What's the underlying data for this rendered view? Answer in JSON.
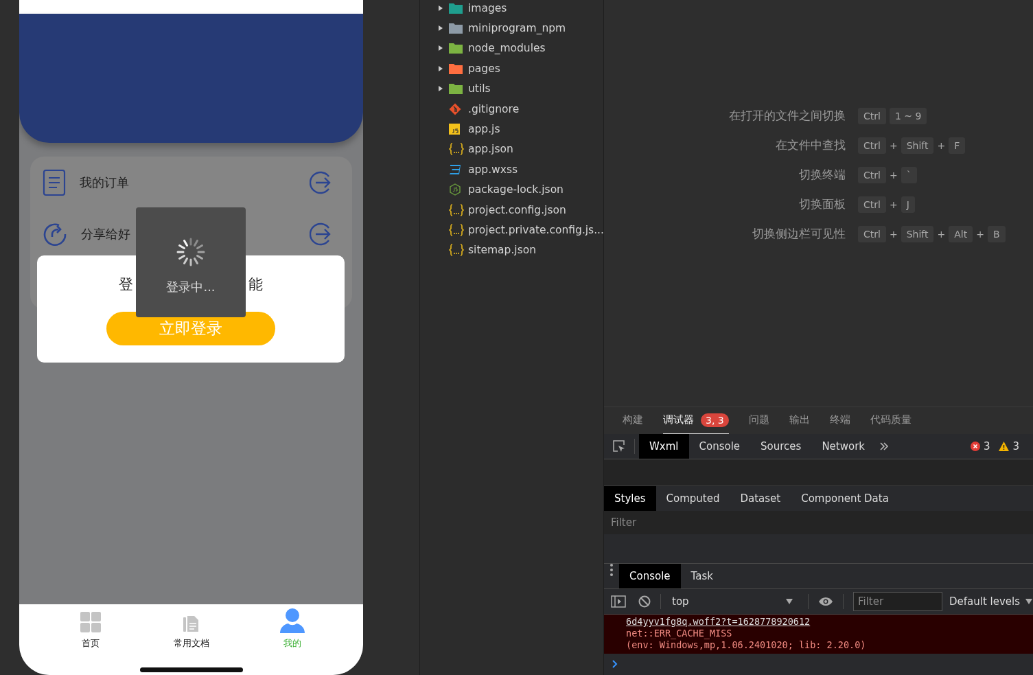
{
  "phone": {
    "menu": [
      {
        "label": "我的订单"
      },
      {
        "label": "分享给好"
      }
    ],
    "login_card": {
      "prompt_parts": [
        "登",
        "能"
      ],
      "button": "立即登录"
    },
    "toast": {
      "text": "登录中..."
    },
    "tab_bar": [
      {
        "label": "首页",
        "selected": false
      },
      {
        "label": "常用文档",
        "selected": false
      },
      {
        "label": "我的",
        "selected": true
      }
    ]
  },
  "file_tree": [
    {
      "name": "images",
      "kind": "folder",
      "color": "#1f9e8e",
      "expanded": false
    },
    {
      "name": "miniprogram_npm",
      "kind": "folder",
      "color": "#8d9aa6",
      "expanded": false
    },
    {
      "name": "node_modules",
      "kind": "folder",
      "color": "#7cb342",
      "expanded": false
    },
    {
      "name": "pages",
      "kind": "folder",
      "color": "#ff6e40",
      "expanded": false
    },
    {
      "name": "utils",
      "kind": "folder",
      "color": "#7cb342",
      "expanded": false
    },
    {
      "name": ".gitignore",
      "kind": "git"
    },
    {
      "name": "app.js",
      "kind": "js"
    },
    {
      "name": "app.json",
      "kind": "json"
    },
    {
      "name": "app.wxss",
      "kind": "css"
    },
    {
      "name": "package-lock.json",
      "kind": "node"
    },
    {
      "name": "project.config.json",
      "kind": "json"
    },
    {
      "name": "project.private.config.js...",
      "kind": "json"
    },
    {
      "name": "sitemap.json",
      "kind": "json"
    }
  ],
  "shortcuts": [
    {
      "label": "在打开的文件之间切换",
      "keys": [
        {
          "kind": "key",
          "text": "Ctrl"
        },
        {
          "kind": "key",
          "text": "1 ~ 9"
        }
      ]
    },
    {
      "label": "在文件中查找",
      "keys": [
        {
          "kind": "key",
          "text": "Ctrl"
        },
        {
          "kind": "plus",
          "text": "+"
        },
        {
          "kind": "key",
          "text": "Shift"
        },
        {
          "kind": "plus",
          "text": "+"
        },
        {
          "kind": "key",
          "text": "F"
        }
      ]
    },
    {
      "label": "切换终端",
      "keys": [
        {
          "kind": "key",
          "text": "Ctrl"
        },
        {
          "kind": "plus",
          "text": "+"
        },
        {
          "kind": "key",
          "text": "`"
        }
      ]
    },
    {
      "label": "切换面板",
      "keys": [
        {
          "kind": "key",
          "text": "Ctrl"
        },
        {
          "kind": "plus",
          "text": "+"
        },
        {
          "kind": "key",
          "text": "J"
        }
      ]
    },
    {
      "label": "切换侧边栏可见性",
      "keys": [
        {
          "kind": "key",
          "text": "Ctrl"
        },
        {
          "kind": "plus",
          "text": "+"
        },
        {
          "kind": "key",
          "text": "Shift"
        },
        {
          "kind": "plus",
          "text": "+"
        },
        {
          "kind": "key",
          "text": "Alt"
        },
        {
          "kind": "plus",
          "text": "+"
        },
        {
          "kind": "key",
          "text": "B"
        }
      ]
    }
  ],
  "panel_tabs": [
    {
      "label": "构建",
      "selected": false
    },
    {
      "label": "调试器",
      "selected": true,
      "badge": "3, 3"
    },
    {
      "label": "问题",
      "selected": false
    },
    {
      "label": "输出",
      "selected": false
    },
    {
      "label": "终端",
      "selected": false
    },
    {
      "label": "代码质量",
      "selected": false
    }
  ],
  "devtools": {
    "tabs": [
      {
        "label": "Wxml",
        "selected": true
      },
      {
        "label": "Console",
        "selected": false
      },
      {
        "label": "Sources",
        "selected": false
      },
      {
        "label": "Network",
        "selected": false
      }
    ],
    "error_count": "3",
    "warning_count": "3",
    "sidebar_tabs": [
      {
        "label": "Styles",
        "selected": true
      },
      {
        "label": "Computed",
        "selected": false
      },
      {
        "label": "Dataset",
        "selected": false
      },
      {
        "label": "Component Data",
        "selected": false
      }
    ],
    "filter_placeholder": "Filter"
  },
  "drawer": {
    "tabs": [
      {
        "label": "Console",
        "selected": true
      },
      {
        "label": "Task",
        "selected": false
      }
    ],
    "context": "top",
    "filter_placeholder": "Filter",
    "levels": "Default levels",
    "log": [
      {
        "kind": "link",
        "text": "6d4yyv1fg8q.woff2?t=1628778920612"
      },
      {
        "kind": "text",
        "text": "net::ERR_CACHE_MISS"
      },
      {
        "kind": "text",
        "text": "(env: Windows,mp,1.06.2401020; lib: 2.20.0)"
      }
    ]
  }
}
